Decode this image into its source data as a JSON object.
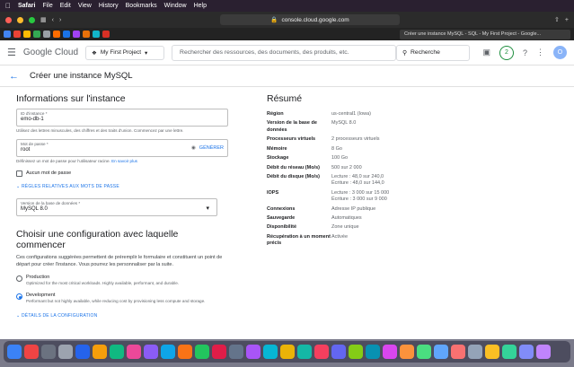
{
  "menubar": {
    "app": "Safari",
    "items": [
      "File",
      "Edit",
      "View",
      "History",
      "Bookmarks",
      "Window",
      "Help"
    ],
    "battery": "96%",
    "clock": "Fri 2 Dec 10:26"
  },
  "browser": {
    "url": "console.cloud.google.com",
    "active_tab": "Créer une instance MySQL - SQL - My First Project - Google..."
  },
  "header": {
    "brand": "Google Cloud",
    "project": "My First Project",
    "search_placeholder": "Rechercher des ressources, des documents, des produits, etc.",
    "search_button": "Recherche",
    "notif_count": "2",
    "avatar": "O"
  },
  "page": {
    "title": "Créer une instance MySQL"
  },
  "instance": {
    "heading": "Informations sur l'instance",
    "id_label": "ID d'instance *",
    "id_value": "emo-db-1",
    "id_hint": "Utilisez des lettres minuscules, des chiffres et des traits d'union. Commencez par une lettre.",
    "pwd_label": "Mot de passe *",
    "pwd_value": "root",
    "generate": "GÉNÉRER",
    "pwd_hint": "Définissez un mot de passe pour l'utilisateur racine.",
    "pwd_link": "En savoir plus",
    "no_pwd": "Aucun mot de passe",
    "rules_link": "RÈGLES RELATIVES AUX MOTS DE PASSE",
    "version_label": "Version de la base de données *",
    "version_value": "MySQL 8.0"
  },
  "config": {
    "heading": "Choisir une configuration avec laquelle commencer",
    "description": "Ces configurations suggérées permettent de préremplir le formulaire et constituent un point de départ pour créer l'instance. Vous pourrez les personnaliser par la suite.",
    "options": [
      {
        "title": "Production",
        "desc": "Optimized for the most critical workloads. Highly available, performant, and durable.",
        "selected": false
      },
      {
        "title": "Development",
        "desc": "Performant but not highly available, while reducing cost by provisioning less compute and storage.",
        "selected": true
      }
    ],
    "details_link": "DÉTAILS DE LA CONFIGURATION"
  },
  "summary": {
    "heading": "Résumé",
    "rows": [
      {
        "k": "Région",
        "v": "us-central1 (Iowa)"
      },
      {
        "k": "Version de la base de données",
        "v": "MySQL 8.0"
      },
      {
        "k": "Processeurs virtuels",
        "v": "2 processeurs virtuels"
      },
      {
        "k": "Mémoire",
        "v": "8 Go"
      },
      {
        "k": "Stockage",
        "v": "100 Go"
      },
      {
        "k": "Débit du réseau (Mo/s)",
        "v": "500 sur 2 000"
      },
      {
        "k": "Débit du disque (Mo/s)",
        "v": "Lecture : 48,0 sur 240,0\nÉcriture : 48,0 sur 144,0"
      },
      {
        "k": "IOPS",
        "v": "Lecture : 3 000 sur 15 000\nÉcriture : 3 000 sur 9 000"
      },
      {
        "k": "Connexions",
        "v": "Adresse IP publique"
      },
      {
        "k": "Sauvegarde",
        "v": "Automatiques"
      },
      {
        "k": "Disponibilité",
        "v": "Zone unique"
      },
      {
        "k": "Récupération à un moment précis",
        "v": "Activée"
      }
    ]
  }
}
